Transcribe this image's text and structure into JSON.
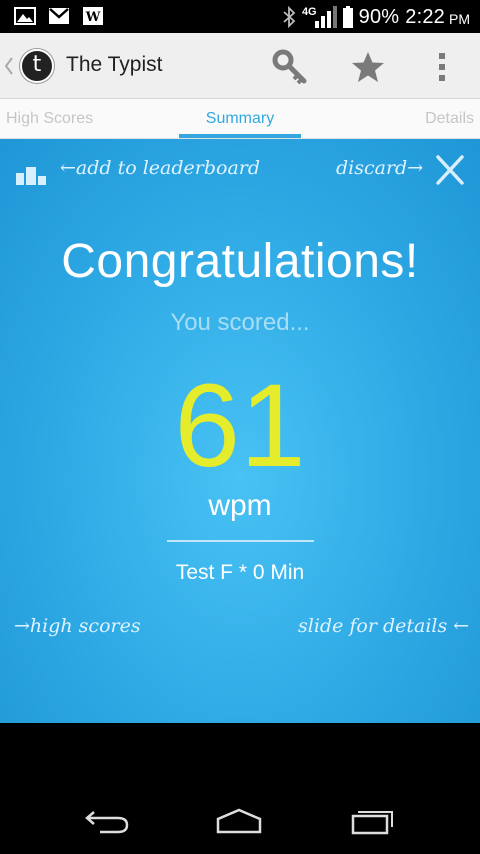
{
  "status_bar": {
    "network": "4G",
    "battery": "90%",
    "time": "2:22",
    "ampm": "PM",
    "left_icons": [
      "image-icon",
      "gmail-icon",
      "wordpress-icon"
    ]
  },
  "action_bar": {
    "logo_letter": "t",
    "title": "The Typist",
    "actions": [
      "key-icon",
      "star-icon",
      "overflow-menu-icon"
    ]
  },
  "tabs": {
    "left": "High Scores",
    "center": "Summary",
    "right": "Details",
    "accent": "#33a8e0"
  },
  "summary": {
    "add_leaderboard": "←add to leaderboard",
    "discard": "discard→",
    "heading": "Congratulations!",
    "subheading": "You scored...",
    "score": "61",
    "unit": "wpm",
    "test_info": "Test F * 0 Min",
    "high_scores_link": "→high scores",
    "details_link": "slide for details ←",
    "colors": {
      "background": "#2ea9e4",
      "score": "#e4ec2c"
    }
  }
}
